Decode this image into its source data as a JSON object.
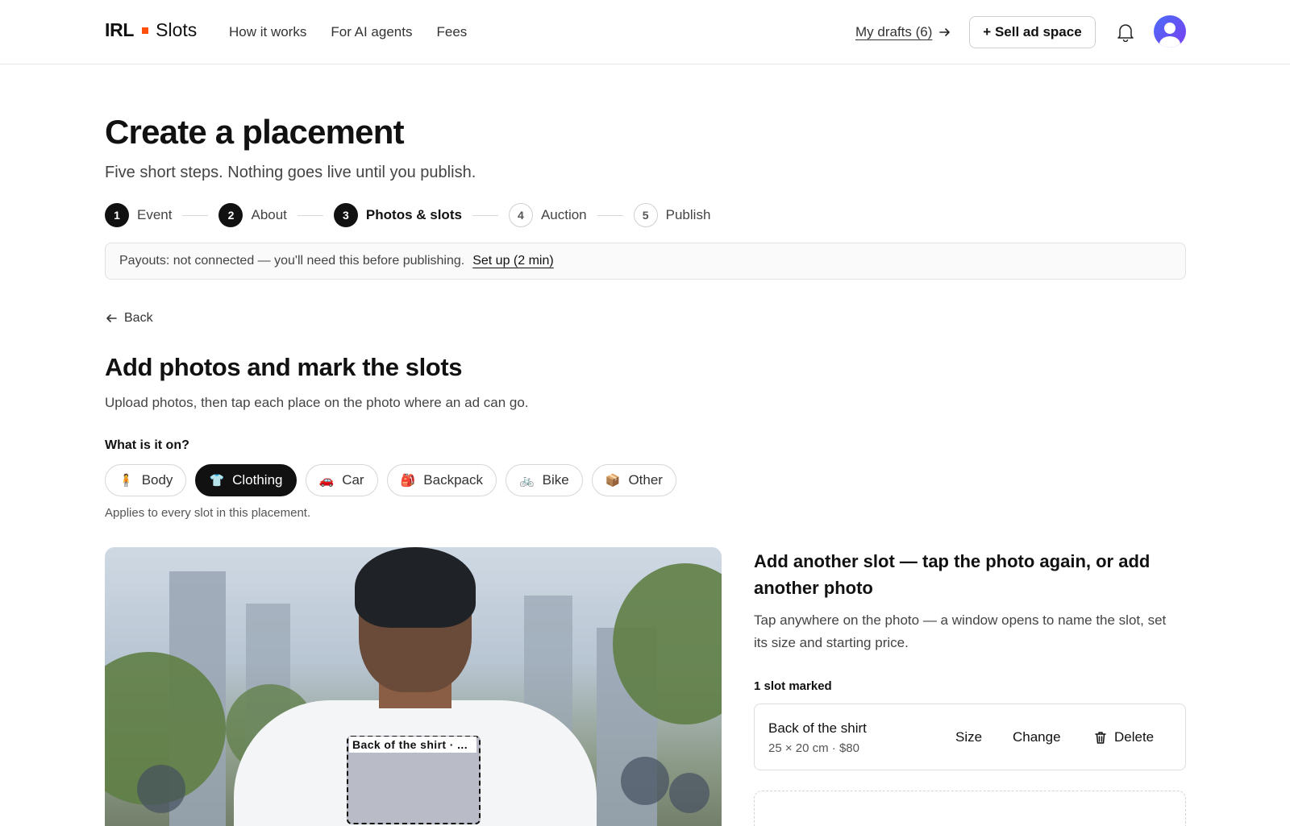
{
  "header": {
    "logo_part1": "IRL",
    "logo_part2": "Slots",
    "nav": [
      "How it works",
      "For AI agents",
      "Fees"
    ],
    "drafts_label": "My drafts (6)",
    "sell_button": "+ Sell ad space",
    "accent_color": "#ff4f0f"
  },
  "page": {
    "title": "Create a placement",
    "subtitle": "Five short steps. Nothing goes live until you publish."
  },
  "steps": [
    {
      "num": "1",
      "label": "Event",
      "state": "done"
    },
    {
      "num": "2",
      "label": "About",
      "state": "done"
    },
    {
      "num": "3",
      "label": "Photos & slots",
      "state": "current"
    },
    {
      "num": "4",
      "label": "Auction",
      "state": "todo"
    },
    {
      "num": "5",
      "label": "Publish",
      "state": "todo"
    }
  ],
  "payout": {
    "text": "Payouts: not connected — you'll need this before publishing.",
    "link": "Set up (2 min)"
  },
  "back_label": "Back",
  "section": {
    "title": "Add photos and mark the slots",
    "description": "Upload photos, then tap each place on the photo where an ad can go.",
    "question": "What is it on?",
    "hint": "Applies to every slot in this placement."
  },
  "categories": [
    {
      "icon": "🧍",
      "label": "Body",
      "selected": false
    },
    {
      "icon": "👕",
      "label": "Clothing",
      "selected": true
    },
    {
      "icon": "🚗",
      "label": "Car",
      "selected": false
    },
    {
      "icon": "🎒",
      "label": "Backpack",
      "selected": false
    },
    {
      "icon": "🚲",
      "label": "Bike",
      "selected": false
    },
    {
      "icon": "📦",
      "label": "Other",
      "selected": false
    }
  ],
  "photo": {
    "slot_tag": "Back of the shirt · ..."
  },
  "side": {
    "title": "Add another slot — tap the photo again, or add another photo",
    "description": "Tap anywhere on the photo — a window opens to name the slot, set its size and starting price.",
    "count": "1 slot marked"
  },
  "slots": [
    {
      "name": "Back of the shirt",
      "meta": "25 × 20 cm · $80",
      "size_label": "Size",
      "change_label": "Change",
      "delete_label": "Delete"
    }
  ]
}
